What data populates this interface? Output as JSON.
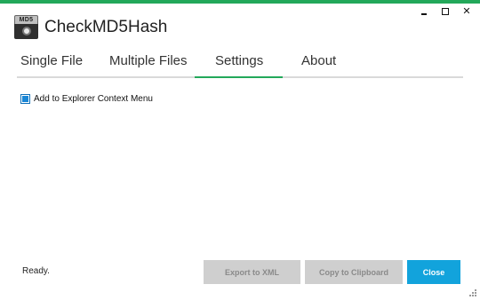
{
  "app": {
    "title": "CheckMD5Hash",
    "icon_label": "MD5"
  },
  "tabs": [
    {
      "label": "Single File",
      "active": false
    },
    {
      "label": "Multiple Files",
      "active": false
    },
    {
      "label": "Settings",
      "active": true
    },
    {
      "label": "About",
      "active": false
    }
  ],
  "settings": {
    "context_menu_label": "Add to Explorer Context Menu",
    "context_menu_checked": true
  },
  "status": "Ready.",
  "buttons": {
    "export": "Export to XML",
    "copy": "Copy to Clipboard",
    "close": "Close"
  },
  "colors": {
    "accent": "#23a85a",
    "primary_button": "#12a3dc",
    "disabled_button": "#cfcfcf",
    "checkbox": "#1a87d6"
  }
}
